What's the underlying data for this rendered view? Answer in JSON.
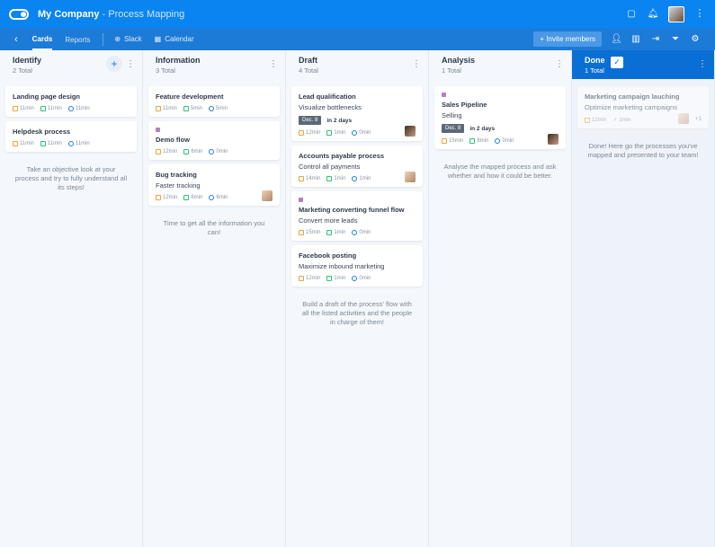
{
  "app": {
    "company": "My Company",
    "separator": " - ",
    "page": "Process Mapping"
  },
  "nav": {
    "tabs": [
      "Cards",
      "Reports"
    ],
    "links": [
      "Slack",
      "Calendar"
    ],
    "invite_label": "+ Invite members"
  },
  "columns": [
    {
      "title": "Identify",
      "total": "2 Total",
      "cards": [
        {
          "title": "Landing page design",
          "metrics": [
            "11min",
            "11min",
            "11min"
          ]
        },
        {
          "title": "Helpdesk process",
          "metrics": [
            "11min",
            "11min",
            "11min"
          ]
        }
      ],
      "hint": "Take an objective look at your process and try to fully understand all its steps!"
    },
    {
      "title": "Information",
      "total": "3 Total",
      "cards": [
        {
          "title": "Feature development",
          "metrics": [
            "11min",
            "5min",
            "5min"
          ]
        },
        {
          "title": "Demo flow",
          "metrics": [
            "12min",
            "6min",
            "0min"
          ]
        },
        {
          "title": "Bug tracking",
          "subtitle": "Faster tracking",
          "metrics": [
            "12min",
            "6min",
            "6min"
          ]
        }
      ],
      "hint": "Time to get all the information you can!"
    },
    {
      "title": "Draft",
      "total": "4 Total",
      "cards": [
        {
          "title": "Lead qualification",
          "subtitle": "Visualize bottlenecks",
          "due_date": "Dec. 8",
          "due_text": "in 2 days",
          "metrics": [
            "12min",
            "1min",
            "0min"
          ]
        },
        {
          "title": "Accounts payable process",
          "subtitle": "Control all payments",
          "metrics": [
            "14min",
            "1min",
            "1min"
          ]
        },
        {
          "title": "Marketing converting funnel flow",
          "subtitle": "Convert more leads",
          "metrics": [
            "15min",
            "1min",
            "0min"
          ]
        },
        {
          "title": "Facebook posting",
          "subtitle": "Maximize inbound marketing",
          "metrics": [
            "12min",
            "1min",
            "0min"
          ]
        }
      ],
      "hint": "Build a draft of the process' flow with all the listed activities and the people in charge of them!"
    },
    {
      "title": "Analysis",
      "total": "1 Total",
      "cards": [
        {
          "title": "Sales Pipeline",
          "subtitle": "Selling",
          "due_date": "Dec. 8",
          "due_text": "in 2 days",
          "metrics": [
            "15min",
            "8min",
            "0min"
          ]
        }
      ],
      "hint": "Analyse the mapped process and ask whether and how it could be better."
    },
    {
      "title": "Done",
      "total": "1 Total",
      "cards": [
        {
          "title": "Marketing campaign lauching",
          "subtitle": "Optimize marketing campaigns",
          "metrics": [
            "12min",
            "1min"
          ],
          "extra": "+1"
        }
      ],
      "hint": "Done! Here go the processes you've mapped and presented to your team!"
    }
  ]
}
